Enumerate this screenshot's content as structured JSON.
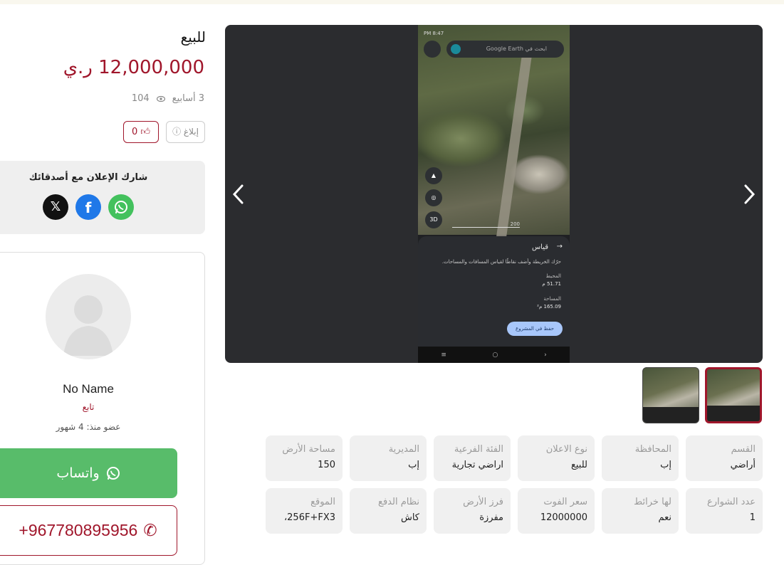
{
  "listing": {
    "ad_type": "للبيع",
    "price": "12,000,000 ر.ي",
    "posted": "3 أسابيع",
    "views": "104",
    "report_label": "إبلاغ",
    "likes": "0"
  },
  "share": {
    "title": "شارك الإعلان مع أصدقائك",
    "x_glyph": "𝕏",
    "fb_glyph": "f"
  },
  "seller": {
    "name": "No Name",
    "role": "تابع",
    "member_since": "عضو منذ: 4 شهور",
    "whatsapp_label": "واتساب",
    "phone": "+967780895956"
  },
  "gallery": {
    "screenshot": {
      "status_time": "8:47 PM",
      "search_placeholder": "ابحث في Google Earth",
      "scale": "200",
      "ctrl_3d": "3D",
      "panel_title": "قياس",
      "hint": "حرّك الخريطة وأضف نقاطًا لقياس المسافات والمساحات.",
      "perimeter_label": "المحيط",
      "perimeter_value": "51.71 م",
      "area_label": "المساحة",
      "area_value": "165.09 م²",
      "save_label": "حفظ في المشروع"
    }
  },
  "specs": [
    {
      "label": "القسم",
      "value": "أراضي"
    },
    {
      "label": "المحافظة",
      "value": "إب"
    },
    {
      "label": "نوع الاعلان",
      "value": "للبيع"
    },
    {
      "label": "الفئة الفرعية",
      "value": "اراضي تجارية"
    },
    {
      "label": "المديرية",
      "value": "إب"
    },
    {
      "label": "مساحة الأرض",
      "value": "150"
    },
    {
      "label": "عدد الشوارع",
      "value": "1"
    },
    {
      "label": "لها خرائط",
      "value": "نعم"
    },
    {
      "label": "سعر الفوت",
      "value": "12000000"
    },
    {
      "label": "فرز الأرض",
      "value": "مفرزة"
    },
    {
      "label": "نظام الدفع",
      "value": "كاش"
    },
    {
      "label": "الموقع",
      "value": "256F+FX3،"
    }
  ],
  "colors": {
    "brand": "#a0162b",
    "whatsapp": "#58bc6a",
    "facebook": "#1f78e8"
  }
}
